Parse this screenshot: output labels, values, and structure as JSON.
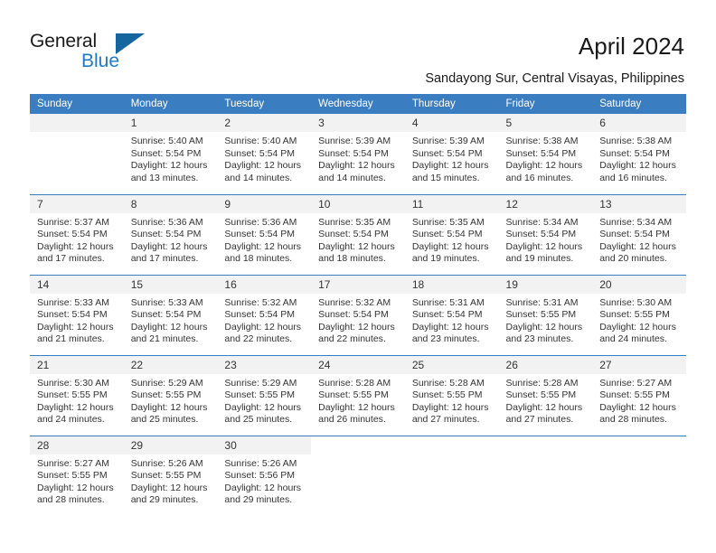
{
  "brand": {
    "name_line1": "General",
    "name_line2": "Blue",
    "accent_color": "#1e7ac4",
    "triangle_color": "#15669e"
  },
  "header": {
    "title": "April 2024",
    "subtitle": "Sandayong Sur, Central Visayas, Philippines"
  },
  "calendar": {
    "header_bg": "#3a7dc0",
    "daynum_bg": "#f2f2f2",
    "weekday_labels": [
      "Sunday",
      "Monday",
      "Tuesday",
      "Wednesday",
      "Thursday",
      "Friday",
      "Saturday"
    ],
    "weeks": [
      [
        {
          "day": "",
          "sunrise": "",
          "sunset": "",
          "daylight_1": "",
          "daylight_2": "",
          "blank": true
        },
        {
          "day": "1",
          "sunrise": "Sunrise: 5:40 AM",
          "sunset": "Sunset: 5:54 PM",
          "daylight_1": "Daylight: 12 hours",
          "daylight_2": "and 13 minutes."
        },
        {
          "day": "2",
          "sunrise": "Sunrise: 5:40 AM",
          "sunset": "Sunset: 5:54 PM",
          "daylight_1": "Daylight: 12 hours",
          "daylight_2": "and 14 minutes."
        },
        {
          "day": "3",
          "sunrise": "Sunrise: 5:39 AM",
          "sunset": "Sunset: 5:54 PM",
          "daylight_1": "Daylight: 12 hours",
          "daylight_2": "and 14 minutes."
        },
        {
          "day": "4",
          "sunrise": "Sunrise: 5:39 AM",
          "sunset": "Sunset: 5:54 PM",
          "daylight_1": "Daylight: 12 hours",
          "daylight_2": "and 15 minutes."
        },
        {
          "day": "5",
          "sunrise": "Sunrise: 5:38 AM",
          "sunset": "Sunset: 5:54 PM",
          "daylight_1": "Daylight: 12 hours",
          "daylight_2": "and 16 minutes."
        },
        {
          "day": "6",
          "sunrise": "Sunrise: 5:38 AM",
          "sunset": "Sunset: 5:54 PM",
          "daylight_1": "Daylight: 12 hours",
          "daylight_2": "and 16 minutes."
        }
      ],
      [
        {
          "day": "7",
          "sunrise": "Sunrise: 5:37 AM",
          "sunset": "Sunset: 5:54 PM",
          "daylight_1": "Daylight: 12 hours",
          "daylight_2": "and 17 minutes."
        },
        {
          "day": "8",
          "sunrise": "Sunrise: 5:36 AM",
          "sunset": "Sunset: 5:54 PM",
          "daylight_1": "Daylight: 12 hours",
          "daylight_2": "and 17 minutes."
        },
        {
          "day": "9",
          "sunrise": "Sunrise: 5:36 AM",
          "sunset": "Sunset: 5:54 PM",
          "daylight_1": "Daylight: 12 hours",
          "daylight_2": "and 18 minutes."
        },
        {
          "day": "10",
          "sunrise": "Sunrise: 5:35 AM",
          "sunset": "Sunset: 5:54 PM",
          "daylight_1": "Daylight: 12 hours",
          "daylight_2": "and 18 minutes."
        },
        {
          "day": "11",
          "sunrise": "Sunrise: 5:35 AM",
          "sunset": "Sunset: 5:54 PM",
          "daylight_1": "Daylight: 12 hours",
          "daylight_2": "and 19 minutes."
        },
        {
          "day": "12",
          "sunrise": "Sunrise: 5:34 AM",
          "sunset": "Sunset: 5:54 PM",
          "daylight_1": "Daylight: 12 hours",
          "daylight_2": "and 19 minutes."
        },
        {
          "day": "13",
          "sunrise": "Sunrise: 5:34 AM",
          "sunset": "Sunset: 5:54 PM",
          "daylight_1": "Daylight: 12 hours",
          "daylight_2": "and 20 minutes."
        }
      ],
      [
        {
          "day": "14",
          "sunrise": "Sunrise: 5:33 AM",
          "sunset": "Sunset: 5:54 PM",
          "daylight_1": "Daylight: 12 hours",
          "daylight_2": "and 21 minutes."
        },
        {
          "day": "15",
          "sunrise": "Sunrise: 5:33 AM",
          "sunset": "Sunset: 5:54 PM",
          "daylight_1": "Daylight: 12 hours",
          "daylight_2": "and 21 minutes."
        },
        {
          "day": "16",
          "sunrise": "Sunrise: 5:32 AM",
          "sunset": "Sunset: 5:54 PM",
          "daylight_1": "Daylight: 12 hours",
          "daylight_2": "and 22 minutes."
        },
        {
          "day": "17",
          "sunrise": "Sunrise: 5:32 AM",
          "sunset": "Sunset: 5:54 PM",
          "daylight_1": "Daylight: 12 hours",
          "daylight_2": "and 22 minutes."
        },
        {
          "day": "18",
          "sunrise": "Sunrise: 5:31 AM",
          "sunset": "Sunset: 5:54 PM",
          "daylight_1": "Daylight: 12 hours",
          "daylight_2": "and 23 minutes."
        },
        {
          "day": "19",
          "sunrise": "Sunrise: 5:31 AM",
          "sunset": "Sunset: 5:55 PM",
          "daylight_1": "Daylight: 12 hours",
          "daylight_2": "and 23 minutes."
        },
        {
          "day": "20",
          "sunrise": "Sunrise: 5:30 AM",
          "sunset": "Sunset: 5:55 PM",
          "daylight_1": "Daylight: 12 hours",
          "daylight_2": "and 24 minutes."
        }
      ],
      [
        {
          "day": "21",
          "sunrise": "Sunrise: 5:30 AM",
          "sunset": "Sunset: 5:55 PM",
          "daylight_1": "Daylight: 12 hours",
          "daylight_2": "and 24 minutes."
        },
        {
          "day": "22",
          "sunrise": "Sunrise: 5:29 AM",
          "sunset": "Sunset: 5:55 PM",
          "daylight_1": "Daylight: 12 hours",
          "daylight_2": "and 25 minutes."
        },
        {
          "day": "23",
          "sunrise": "Sunrise: 5:29 AM",
          "sunset": "Sunset: 5:55 PM",
          "daylight_1": "Daylight: 12 hours",
          "daylight_2": "and 25 minutes."
        },
        {
          "day": "24",
          "sunrise": "Sunrise: 5:28 AM",
          "sunset": "Sunset: 5:55 PM",
          "daylight_1": "Daylight: 12 hours",
          "daylight_2": "and 26 minutes."
        },
        {
          "day": "25",
          "sunrise": "Sunrise: 5:28 AM",
          "sunset": "Sunset: 5:55 PM",
          "daylight_1": "Daylight: 12 hours",
          "daylight_2": "and 27 minutes."
        },
        {
          "day": "26",
          "sunrise": "Sunrise: 5:28 AM",
          "sunset": "Sunset: 5:55 PM",
          "daylight_1": "Daylight: 12 hours",
          "daylight_2": "and 27 minutes."
        },
        {
          "day": "27",
          "sunrise": "Sunrise: 5:27 AM",
          "sunset": "Sunset: 5:55 PM",
          "daylight_1": "Daylight: 12 hours",
          "daylight_2": "and 28 minutes."
        }
      ],
      [
        {
          "day": "28",
          "sunrise": "Sunrise: 5:27 AM",
          "sunset": "Sunset: 5:55 PM",
          "daylight_1": "Daylight: 12 hours",
          "daylight_2": "and 28 minutes."
        },
        {
          "day": "29",
          "sunrise": "Sunrise: 5:26 AM",
          "sunset": "Sunset: 5:55 PM",
          "daylight_1": "Daylight: 12 hours",
          "daylight_2": "and 29 minutes."
        },
        {
          "day": "30",
          "sunrise": "Sunrise: 5:26 AM",
          "sunset": "Sunset: 5:56 PM",
          "daylight_1": "Daylight: 12 hours",
          "daylight_2": "and 29 minutes."
        },
        {
          "day": "",
          "sunrise": "",
          "sunset": "",
          "daylight_1": "",
          "daylight_2": "",
          "void": true
        },
        {
          "day": "",
          "sunrise": "",
          "sunset": "",
          "daylight_1": "",
          "daylight_2": "",
          "void": true
        },
        {
          "day": "",
          "sunrise": "",
          "sunset": "",
          "daylight_1": "",
          "daylight_2": "",
          "void": true
        },
        {
          "day": "",
          "sunrise": "",
          "sunset": "",
          "daylight_1": "",
          "daylight_2": "",
          "void": true
        }
      ]
    ]
  }
}
